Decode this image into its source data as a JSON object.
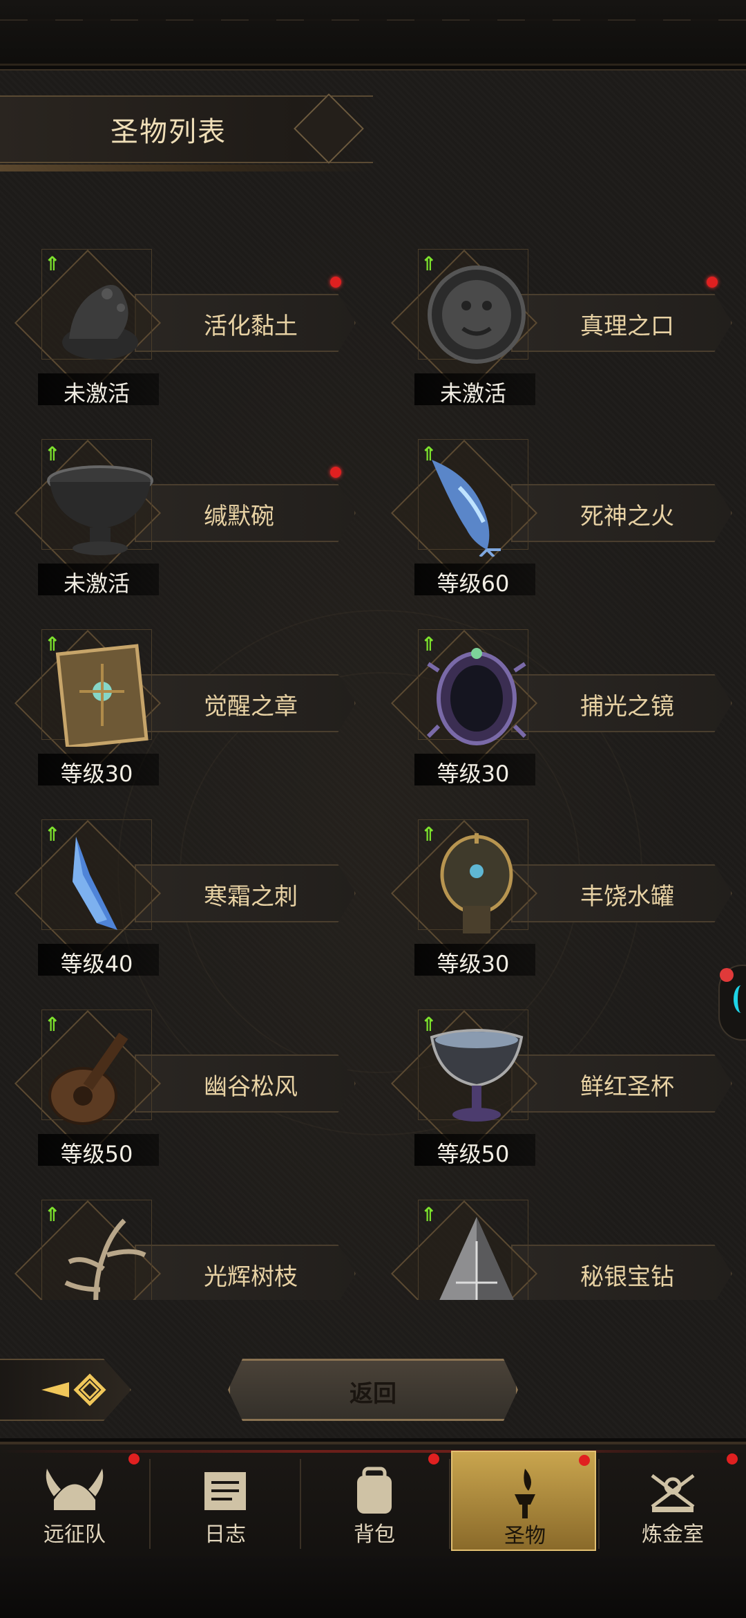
{
  "title": "圣物列表",
  "relics": [
    {
      "name": "活化黏土",
      "status": "未激活",
      "upgrade": true,
      "red_dot": true,
      "icon": "clay-icon"
    },
    {
      "name": "真理之口",
      "status": "未激活",
      "upgrade": true,
      "red_dot": true,
      "icon": "stone-face-icon"
    },
    {
      "name": "缄默碗",
      "status": "未激活",
      "upgrade": true,
      "red_dot": true,
      "icon": "bowl-icon"
    },
    {
      "name": "死神之火",
      "status": "等级60",
      "upgrade": true,
      "red_dot": false,
      "icon": "blue-flame-hand-icon"
    },
    {
      "name": "觉醒之章",
      "status": "等级30",
      "upgrade": true,
      "red_dot": false,
      "icon": "book-icon"
    },
    {
      "name": "捕光之镜",
      "status": "等级30",
      "upgrade": true,
      "red_dot": false,
      "icon": "mirror-icon"
    },
    {
      "name": "寒霜之刺",
      "status": "等级40",
      "upgrade": true,
      "red_dot": false,
      "icon": "ice-crystal-icon"
    },
    {
      "name": "丰饶水罐",
      "status": "等级30",
      "upgrade": true,
      "red_dot": false,
      "icon": "vase-icon"
    },
    {
      "name": "幽谷松风",
      "status": "等级50",
      "upgrade": true,
      "red_dot": false,
      "icon": "lute-icon"
    },
    {
      "name": "鲜红圣杯",
      "status": "等级50",
      "upgrade": true,
      "red_dot": false,
      "icon": "chalice-icon"
    },
    {
      "name": "光辉树枝",
      "status": "",
      "upgrade": true,
      "red_dot": false,
      "icon": "branch-icon"
    },
    {
      "name": "秘银宝钻",
      "status": "",
      "upgrade": true,
      "red_dot": false,
      "icon": "pyramid-gem-icon"
    }
  ],
  "return_label": "返回",
  "tabs": [
    {
      "label": "远征队",
      "icon": "viking-helmet-icon",
      "red_dot": true,
      "active": false
    },
    {
      "label": "日志",
      "icon": "scroll-icon",
      "red_dot": false,
      "active": false
    },
    {
      "label": "背包",
      "icon": "backpack-icon",
      "red_dot": true,
      "active": false
    },
    {
      "label": "圣物",
      "icon": "torch-icon",
      "red_dot": true,
      "active": true
    },
    {
      "label": "炼金室",
      "icon": "alchemy-icon",
      "red_dot": true,
      "active": false
    }
  ],
  "colors": {
    "accent_gold": "#c9a54e",
    "upgrade_green": "#7de32d",
    "notify_red": "#e02020",
    "float_cyan": "#1fd3e6"
  }
}
